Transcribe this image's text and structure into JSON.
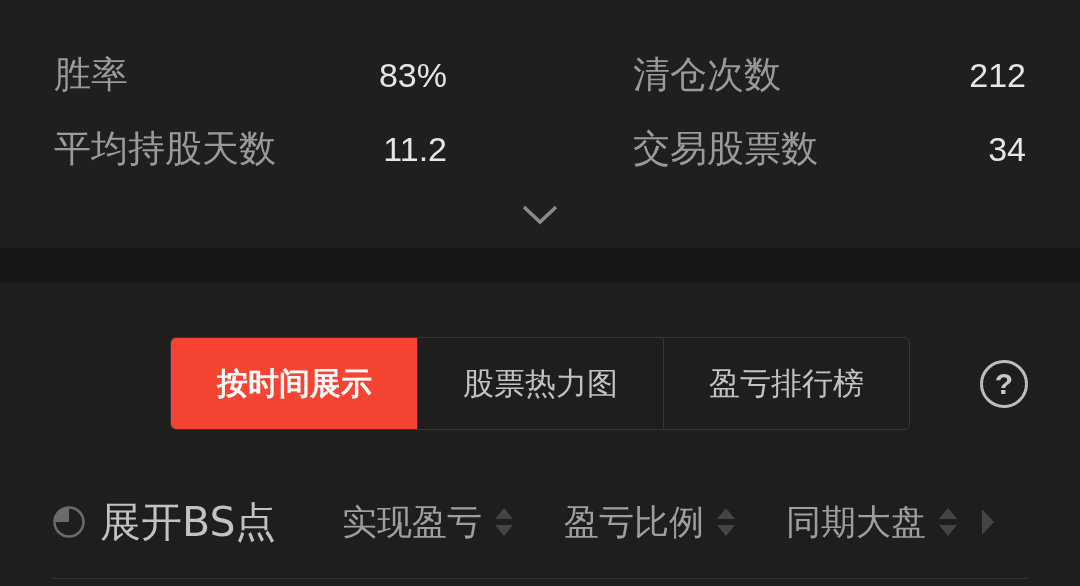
{
  "stats": [
    {
      "label": "胜率",
      "value": "83%"
    },
    {
      "label": "清仓次数",
      "value": "212"
    },
    {
      "label": "平均持股天数",
      "value": "11.2"
    },
    {
      "label": "交易股票数",
      "value": "34"
    }
  ],
  "view_tabs": [
    {
      "label": "按时间展示",
      "selected": true
    },
    {
      "label": "股票热力图",
      "selected": false
    },
    {
      "label": "盈亏排行榜",
      "selected": false
    }
  ],
  "help": {
    "label": "?"
  },
  "table_header": {
    "toggle_label": "展开BS点",
    "columns": [
      {
        "label": "实现盈亏"
      },
      {
        "label": "盈亏比例"
      },
      {
        "label": "同期大盘"
      }
    ]
  }
}
